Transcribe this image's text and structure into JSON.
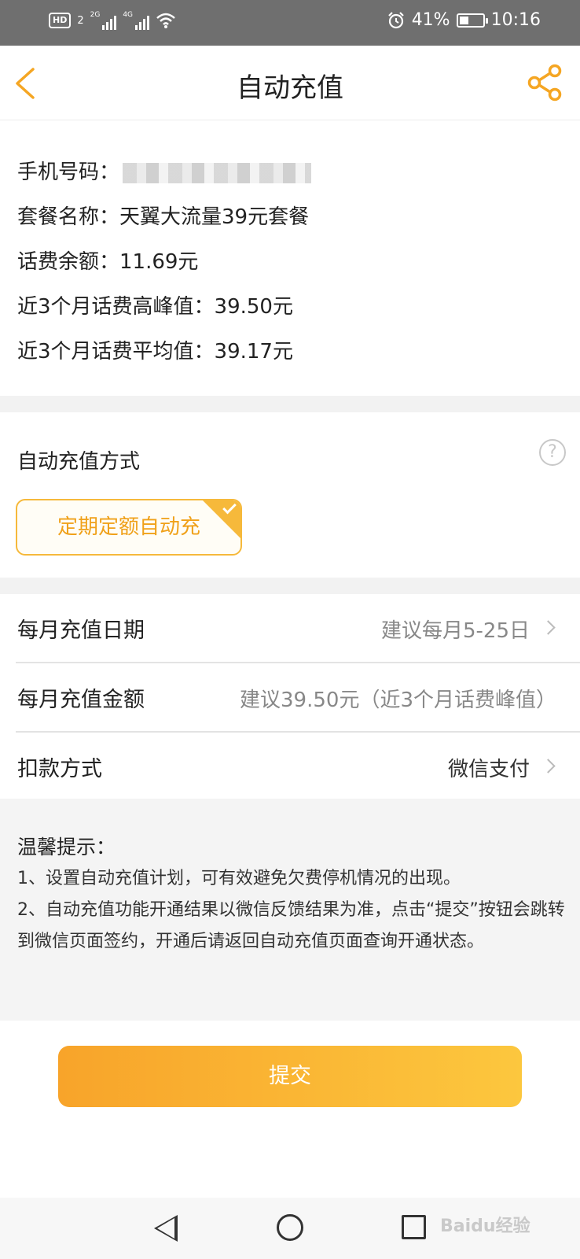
{
  "status_bar": {
    "hd": "HD",
    "sim_index": "2",
    "net1": "2G",
    "net2": "4G",
    "battery_percent": "41%",
    "battery_level": 0.41,
    "time": "10:16"
  },
  "header": {
    "title": "自动充值"
  },
  "info": {
    "phone_label": "手机号码：",
    "plan": "套餐名称：天翼大流量39元套餐",
    "balance": "话费余额：11.69元",
    "peak": "近3个月话费高峰值：39.50元",
    "average": "近3个月话费平均值：39.17元"
  },
  "method": {
    "title": "自动充值方式",
    "option_label": "定期定额自动充",
    "help": "?"
  },
  "settings": {
    "rows": [
      {
        "label": "每月充值日期",
        "value": "建议每月5-25日"
      },
      {
        "label": "每月充值金额",
        "value": "建议39.50元（近3个月话费峰值）"
      },
      {
        "label": "扣款方式",
        "value": "微信支付"
      }
    ]
  },
  "tips": {
    "title": "温馨提示：",
    "line1": "1、设置自动充值计划，可有效避免欠费停机情况的出现。",
    "line2": "2、自动充值功能开通结果以微信反馈结果为准，点击“提交”按钮会跳转到微信页面签约，开通后请返回自动充值页面查询开通状态。"
  },
  "submit_label": "提交",
  "watermark": "Baidu经验",
  "colors": {
    "accent": "#f8a42a",
    "accent_light": "#fcc73e"
  }
}
